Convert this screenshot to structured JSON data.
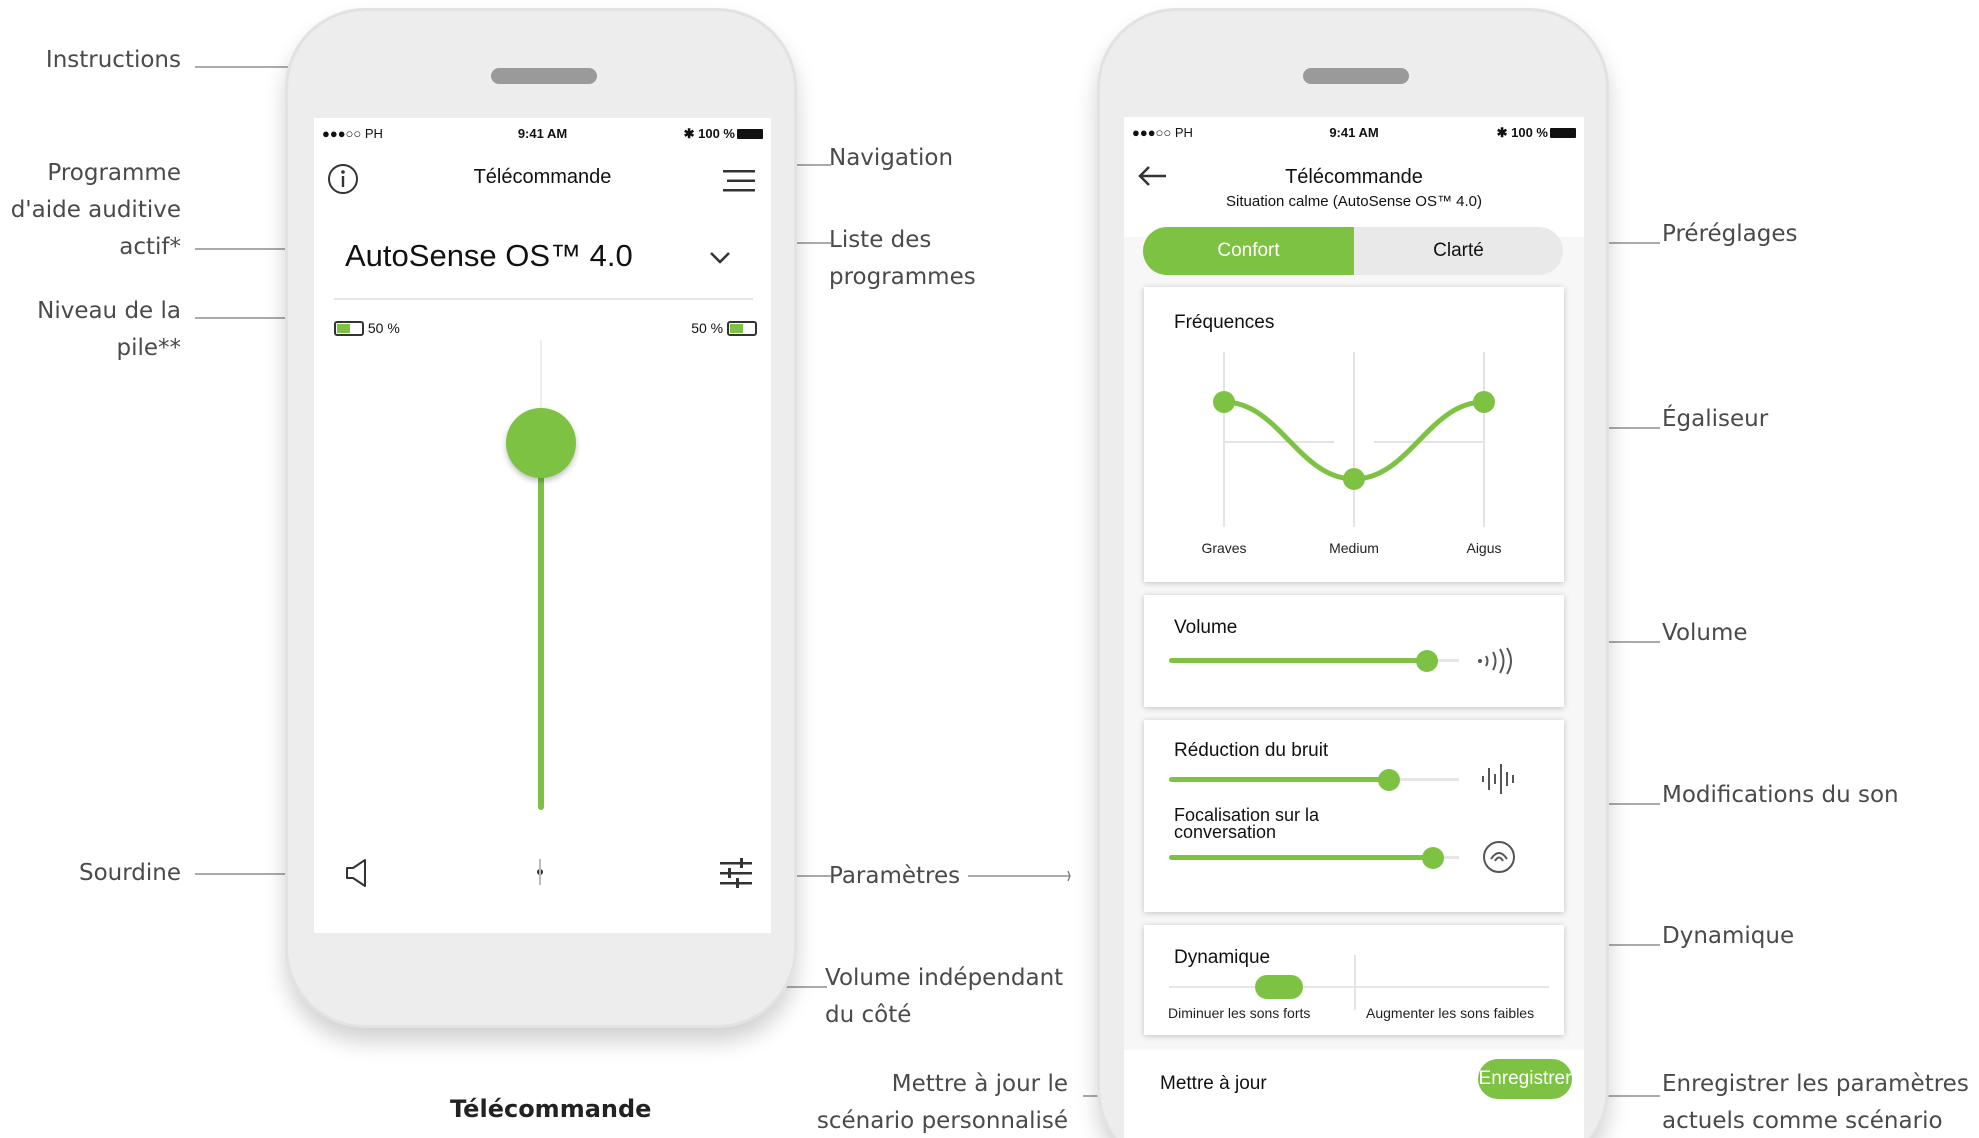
{
  "annotations": {
    "instructions": "Instructions",
    "program_lines": [
      "Programme",
      "d'aide auditive",
      "actif*"
    ],
    "battery_lines": [
      "Niveau de la",
      "pile**"
    ],
    "mute": "Sourdine",
    "navigation": "Navigation",
    "program_list_lines": [
      "Liste des",
      "programmes"
    ],
    "settings": "Paramètres",
    "side_volume_lines": [
      "Volume indépendant",
      "du côté"
    ],
    "update_lines": [
      "Mettre à jour le",
      "scénario personnalisé"
    ],
    "presets": "Préréglages",
    "equalizer": "Égaliseur",
    "volume": "Volume",
    "sound_mods": "Modifications du son",
    "dynamics": "Dynamique",
    "save_lines": [
      "Enregistrer les paramètres",
      "actuels comme scénario"
    ]
  },
  "caption": "Télécommande",
  "phone1": {
    "status": {
      "carrier": "●●●○○ PH ",
      "time": "9:41 AM",
      "battery": "100 %"
    },
    "title": "Télécommande",
    "program": "AutoSense OS™ 4.0",
    "battery_left": "50 %",
    "battery_right": "50 %",
    "volume_level": 0.78
  },
  "phone2": {
    "status": {
      "carrier": "●●●○○ PH ",
      "time": "9:41 AM",
      "battery": "100 %"
    },
    "title": "Télécommande",
    "subtitle": "Situation calme (AutoSense OS™ 4.0)",
    "presets": {
      "active": "Confort",
      "other": "Clarté"
    },
    "equalizer": {
      "title": "Fréquences",
      "bands": [
        "Graves",
        "Medium",
        "Aigus"
      ],
      "levels": [
        0.5,
        0.0,
        0.5
      ]
    },
    "volume": {
      "title": "Volume",
      "level": 0.89
    },
    "noise_reduction": {
      "title": "Réduction du bruit",
      "level": 0.76
    },
    "speech_focus": {
      "title_lines": [
        "Focalisation sur la",
        "conversation"
      ],
      "level": 0.91
    },
    "dynamics": {
      "title": "Dynamique",
      "left_label": "Diminuer les sons forts",
      "right_label": "Augmenter les sons faibles",
      "level": 0.29
    },
    "update_label": "Mettre à jour",
    "save_label": "Enregistrer"
  },
  "colors": {
    "accent": "#7dc242",
    "annotation_text": "#4a4a4a",
    "leader": "#666666"
  }
}
